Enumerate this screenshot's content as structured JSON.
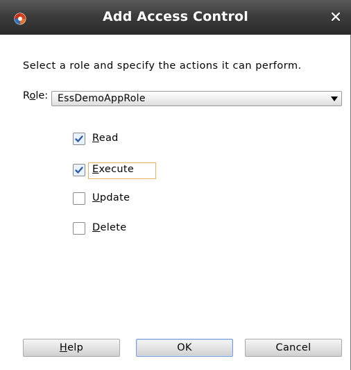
{
  "window": {
    "title": "Add Access Control",
    "close_icon": "close-icon",
    "app_icon": "oracle-app-icon"
  },
  "instructions": "Select a role and specify the actions it can perform.",
  "role": {
    "label": "Role:",
    "selected": "EssDemoAppRole"
  },
  "actions": [
    {
      "label": "Read",
      "checked": true
    },
    {
      "label": "Execute",
      "checked": true,
      "focused": true
    },
    {
      "label": "Update",
      "checked": false
    },
    {
      "label": "Delete",
      "checked": false
    }
  ],
  "buttons": {
    "help": "Help",
    "ok": "OK",
    "cancel": "Cancel"
  },
  "colors": {
    "titlebar": "#3c3c3c",
    "focus_border": "#e5b35a",
    "checkmark": "#2a5db0"
  }
}
